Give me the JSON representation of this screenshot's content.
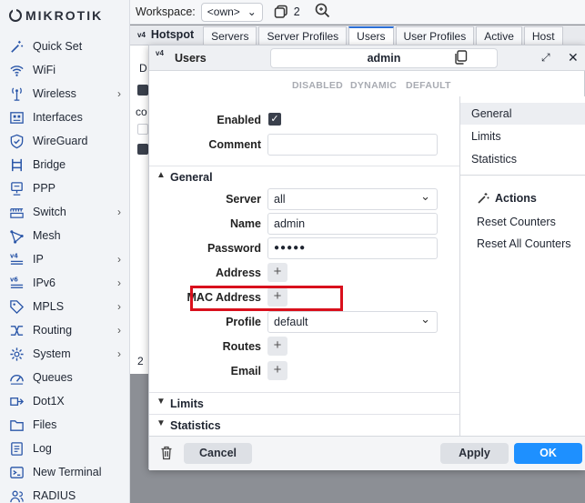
{
  "brand": {
    "logo_text": "MikroTik"
  },
  "sidebar": {
    "items": [
      {
        "label": "Quick Set",
        "icon": "wand-icon",
        "submenu": false
      },
      {
        "label": "WiFi",
        "icon": "wifi-icon",
        "submenu": false
      },
      {
        "label": "Wireless",
        "icon": "antenna-icon",
        "submenu": true
      },
      {
        "label": "Interfaces",
        "icon": "interfaces-icon",
        "submenu": false
      },
      {
        "label": "WireGuard",
        "icon": "shield-icon",
        "submenu": false
      },
      {
        "label": "Bridge",
        "icon": "bridge-icon",
        "submenu": false
      },
      {
        "label": "PPP",
        "icon": "ppp-icon",
        "submenu": false
      },
      {
        "label": "Switch",
        "icon": "switch-icon",
        "submenu": true
      },
      {
        "label": "Mesh",
        "icon": "mesh-icon",
        "submenu": false
      },
      {
        "label": "IP",
        "icon": "ipv4-icon",
        "submenu": true
      },
      {
        "label": "IPv6",
        "icon": "ipv6-icon",
        "submenu": true
      },
      {
        "label": "MPLS",
        "icon": "tag-icon",
        "submenu": true
      },
      {
        "label": "Routing",
        "icon": "routing-icon",
        "submenu": true
      },
      {
        "label": "System",
        "icon": "gear-icon",
        "submenu": true
      },
      {
        "label": "Queues",
        "icon": "gauge-icon",
        "submenu": false
      },
      {
        "label": "Dot1X",
        "icon": "dot1x-icon",
        "submenu": false
      },
      {
        "label": "Files",
        "icon": "folder-icon",
        "submenu": false
      },
      {
        "label": "Log",
        "icon": "log-icon",
        "submenu": false
      },
      {
        "label": "New Terminal",
        "icon": "terminal-icon",
        "submenu": false
      },
      {
        "label": "RADIUS",
        "icon": "users-icon",
        "submenu": false
      }
    ]
  },
  "topbar": {
    "workspace_label": "Workspace:",
    "workspace_value": "<own>",
    "window_count": "2"
  },
  "background_window": {
    "badge": "v4",
    "title": "Hotspot",
    "tabs": [
      "Servers",
      "Server Profiles",
      "Users",
      "User Profiles",
      "Active",
      "Host"
    ],
    "active_tab": "Users",
    "row_text_1": "D",
    "row_text_2": "co",
    "row_text_3": "2"
  },
  "dialog": {
    "badge": "v4",
    "title": "Users",
    "record_name": "admin",
    "flags": [
      "DISABLED",
      "DYNAMIC",
      "DEFAULT"
    ],
    "enabled_label": "Enabled",
    "enabled_checked": true,
    "comment_label": "Comment",
    "comment_value": "",
    "section_general": "General",
    "server_label": "Server",
    "server_value": "all",
    "name_label": "Name",
    "name_value": "admin",
    "password_label": "Password",
    "password_value": "●●●●●",
    "address_label": "Address",
    "mac_label": "MAC Address",
    "profile_label": "Profile",
    "profile_value": "default",
    "routes_label": "Routes",
    "email_label": "Email",
    "section_limits": "Limits",
    "section_statistics": "Statistics",
    "side_nav": [
      "General",
      "Limits",
      "Statistics"
    ],
    "side_active": "General",
    "actions_title": "Actions",
    "actions": [
      "Reset Counters",
      "Reset All Counters"
    ],
    "cancel_label": "Cancel",
    "apply_label": "Apply",
    "ok_label": "OK"
  },
  "colors": {
    "accent": "#1e90ff",
    "icon": "#2a56a8",
    "highlight": "#d9101c"
  }
}
